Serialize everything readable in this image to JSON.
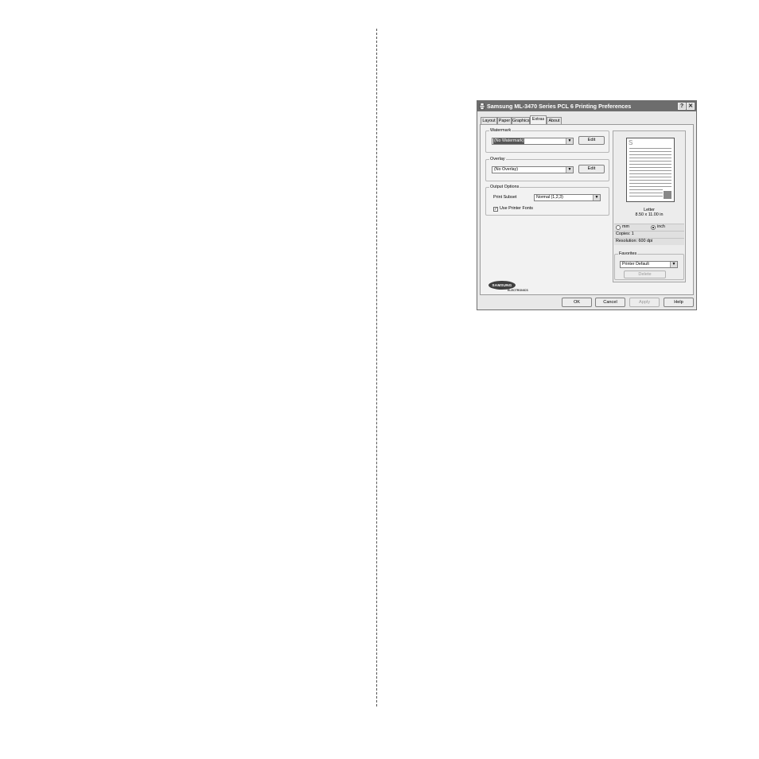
{
  "dialog": {
    "title": "Samsung ML-3470 Series PCL 6 Printing Preferences",
    "help_glyph": "?",
    "close_glyph": "✕"
  },
  "tabs": [
    "Layout",
    "Paper",
    "Graphics",
    "Extras",
    "About"
  ],
  "active_tab": "Extras",
  "watermark": {
    "label": "Watermark",
    "value": "(No Watermark)",
    "edit_label": "Edit"
  },
  "overlay": {
    "label": "Overlay",
    "value": "(No Overlay)",
    "edit_label": "Edit"
  },
  "output_options": {
    "label": "Output Options",
    "print_subset_label": "Print Subset",
    "print_subset_value": "Normal (1,2,3)",
    "use_printer_fonts_label": "Use Printer Fonts",
    "use_printer_fonts_checked": true
  },
  "preview": {
    "paper_letter": "S",
    "paper_name": "Letter",
    "paper_size": "8.50 x 11.00 in",
    "unit_mm_label": "mm",
    "unit_inch_label": "inch",
    "selected_unit": "inch",
    "copies": "Copies: 1",
    "resolution": "Resolution: 600 dpi"
  },
  "favorites": {
    "label": "Favorites",
    "value": "Printer Default",
    "delete_label": "Delete"
  },
  "logo": {
    "brand": "SAMSUNG",
    "sub": "ELECTRONICS"
  },
  "buttons": {
    "ok": "OK",
    "cancel": "Cancel",
    "apply": "Apply",
    "help": "Help"
  },
  "colors": {
    "titlebar": "#6d6d6d",
    "dialog_bg": "#e8e8e8",
    "divider": "#555555"
  }
}
